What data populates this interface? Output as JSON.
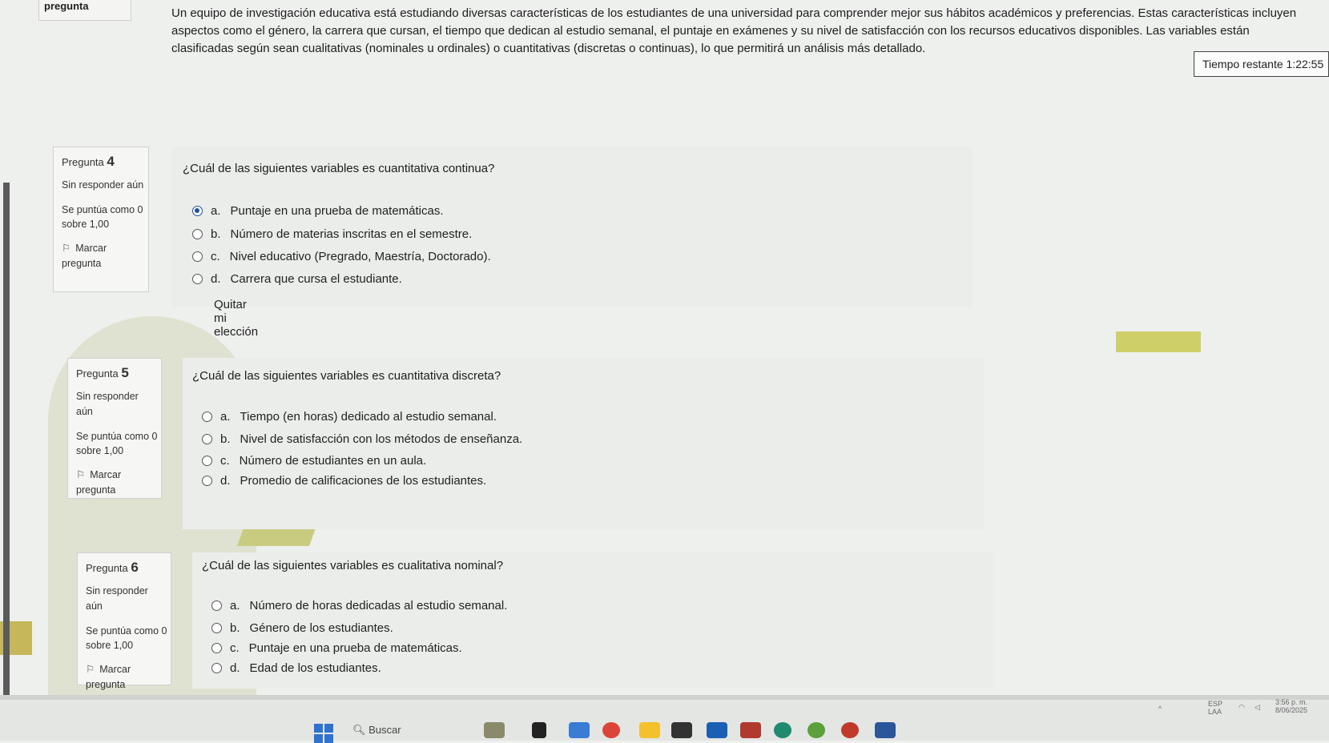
{
  "top_tab": {
    "label": "pregunta"
  },
  "intro": "Un equipo de investigación educativa está estudiando diversas características de los estudiantes de una universidad para comprender mejor sus hábitos académicos y preferencias. Estas características incluyen aspectos como el género, la carrera que cursan, el tiempo que dedican al estudio semanal, el puntaje en exámenes y su nivel de satisfacción con los recursos educativos disponibles. Las variables están clasificadas según sean cualitativas (nominales u ordinales) o cuantitativas (discretas o continuas), lo que permitirá un análisis más detallado.",
  "timer": "Tiempo restante 1:22:55",
  "questions": [
    {
      "label": "Pregunta",
      "number": "4",
      "state": "Sin responder aún",
      "grade": "Se puntúa como 0 sobre 1,00",
      "flag_label": "Marcar pregunta",
      "text": "¿Cuál de las siguientes variables es cuantitativa continua?",
      "options": [
        {
          "letter": "a.",
          "text": "Puntaje en una prueba de matemáticas.",
          "checked": true
        },
        {
          "letter": "b.",
          "text": "Número de materias inscritas en el semestre.",
          "checked": false
        },
        {
          "letter": "c.",
          "text": "Nivel educativo (Pregrado, Maestría, Doctorado).",
          "checked": false
        },
        {
          "letter": "d.",
          "text": "Carrera que cursa el estudiante.",
          "checked": false
        }
      ],
      "clear_choice": "Quitar mi elección"
    },
    {
      "label": "Pregunta",
      "number": "5",
      "state": "Sin responder aún",
      "grade": "Se puntúa como 0 sobre 1,00",
      "flag_label": "Marcar pregunta",
      "text": "¿Cuál de las siguientes variables es cuantitativa discreta?",
      "options": [
        {
          "letter": "a.",
          "text": "Tiempo (en horas) dedicado al estudio semanal.",
          "checked": false
        },
        {
          "letter": "b.",
          "text": "Nivel de satisfacción con los métodos de enseñanza.",
          "checked": false
        },
        {
          "letter": "c.",
          "text": "Número de estudiantes en un aula.",
          "checked": false
        },
        {
          "letter": "d.",
          "text": "Promedio de calificaciones de los estudiantes.",
          "checked": false
        }
      ]
    },
    {
      "label": "Pregunta",
      "number": "6",
      "state": "Sin responder aún",
      "grade": "Se puntúa como 0 sobre 1,00",
      "flag_label": "Marcar pregunta",
      "text": "¿Cuál de las siguientes variables es cualitativa nominal?",
      "options": [
        {
          "letter": "a.",
          "text": "Número de horas dedicadas al estudio semanal.",
          "checked": false
        },
        {
          "letter": "b.",
          "text": "Género de los estudiantes.",
          "checked": false
        },
        {
          "letter": "c.",
          "text": "Puntaje en una prueba de matemáticas.",
          "checked": false
        },
        {
          "letter": "d.",
          "text": "Edad de los estudiantes.",
          "checked": false
        }
      ]
    }
  ],
  "taskbar": {
    "search_label": "Buscar",
    "lang": "ESP",
    "layout": "LAA",
    "time": "3:56 p. m.",
    "date": "8/06/2025",
    "colors": {
      "start": "#2f73d1"
    }
  }
}
